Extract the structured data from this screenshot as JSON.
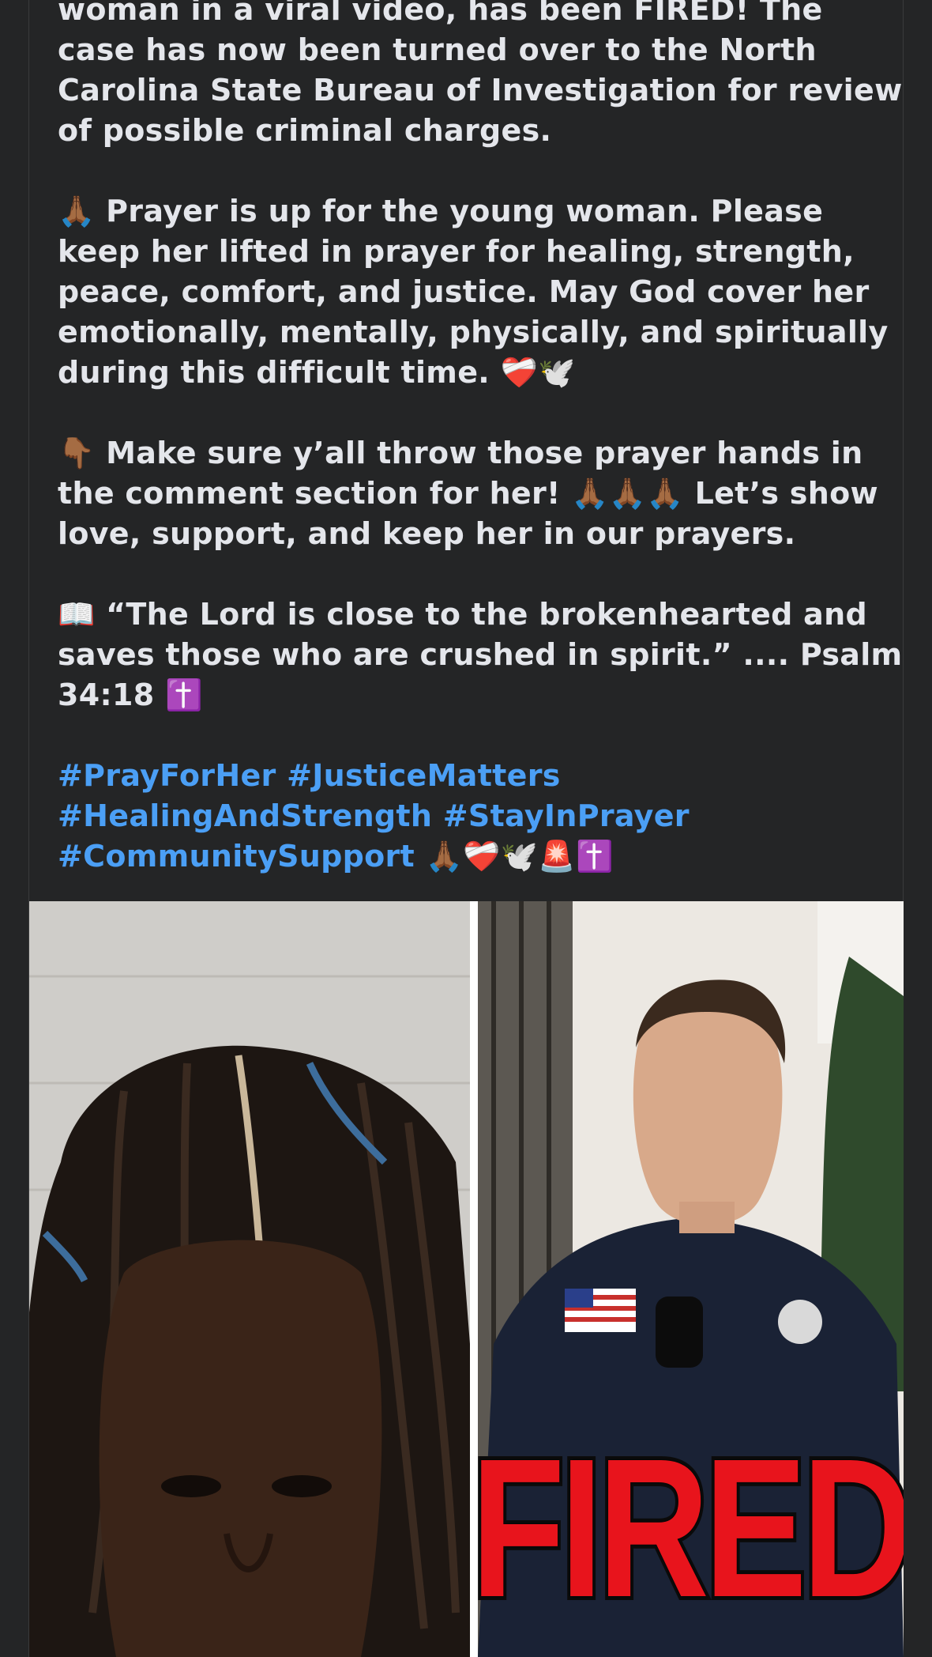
{
  "post": {
    "paragraphs": [
      "woman in a viral video, has been FIRED! The case has now been turned over to the North Carolina State Bureau of Investigation for review of possible criminal charges.",
      "🙏🏾 Prayer is up for the young woman. Please keep her lifted in prayer for healing, strength, peace, comfort, and justice. May God cover her emotionally, mentally, physically, and spiritually during this difficult time. ❤️‍🩹🕊️",
      "👇🏾 Make sure y’all throw those prayer hands in the comment section for her! 🙏🏾🙏🏾🙏🏾 Let’s show love, support, and keep her in our prayers.",
      "📖 “The Lord is close to the brokenhearted and saves those who are crushed in spirit.” .... Psalm 34:18 ✝️"
    ],
    "hashtags": [
      "#PrayForHer",
      "#JusticeMatters",
      "#HealingAndStrength",
      "#StayInPrayer",
      "#CommunitySupport"
    ],
    "hashtag_emojis": "🙏🏾❤️‍🩹🕊️🚨✝️"
  },
  "image": {
    "overlay_text": "FIRED",
    "overlay_color": "#e8141c",
    "stroke_color": "#0b0b0b"
  },
  "theme": {
    "background": "#242526",
    "text": "#e4e6eb",
    "link": "#4b9ff5"
  }
}
